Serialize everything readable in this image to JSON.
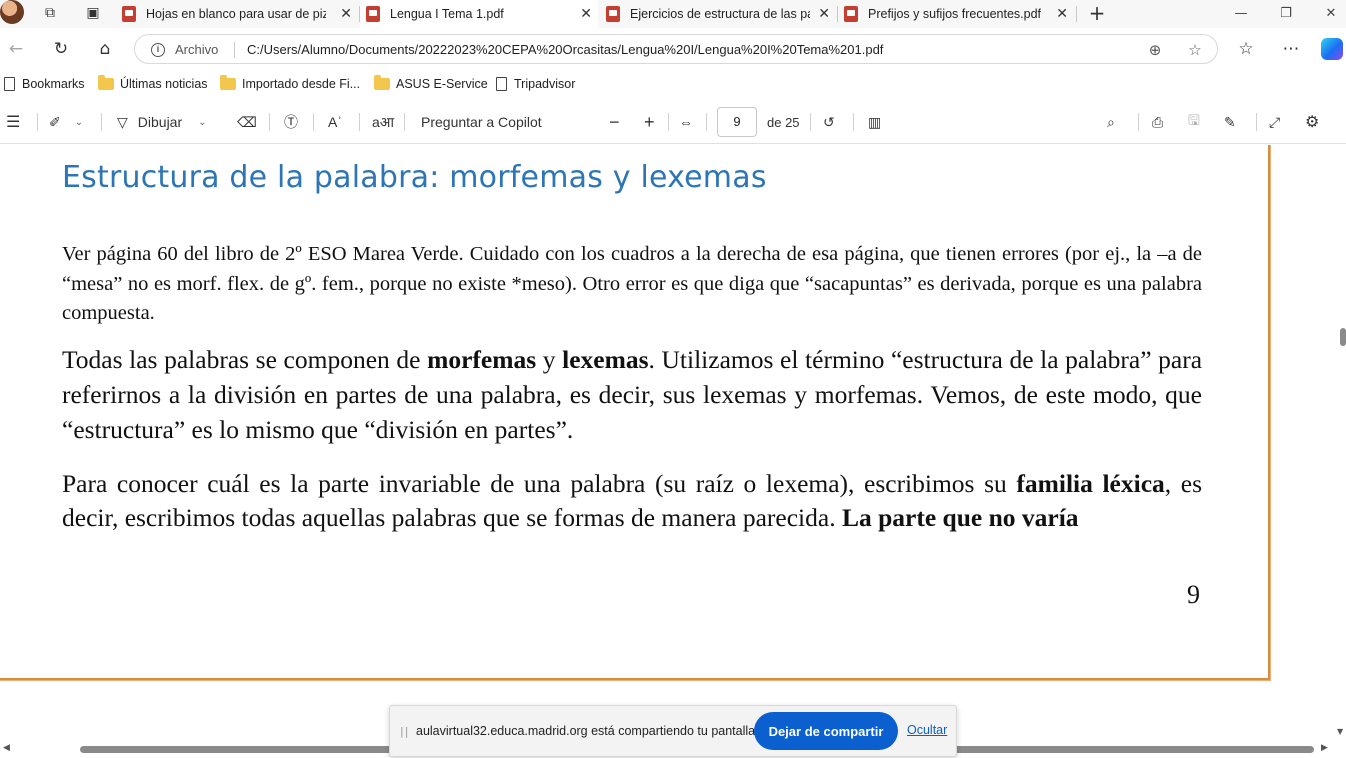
{
  "tabs": [
    {
      "label": "Hojas en blanco para usar de piza",
      "active": false
    },
    {
      "label": "Lengua I Tema 1.pdf",
      "active": true
    },
    {
      "label": "Ejercicios de estructura de las pal",
      "active": false
    },
    {
      "label": "Prefijos y sufijos frecuentes.pdf",
      "active": false
    }
  ],
  "address": {
    "site_info": "Archivo",
    "url": "C:/Users/Alumno/Documents/20222023%20CEPA%20Orcasitas/Lengua%20I/Lengua%20I%20Tema%201.pdf"
  },
  "bookmarks": [
    {
      "label": "Bookmarks",
      "icon": "doc-icon"
    },
    {
      "label": "Últimas noticias",
      "icon": "folder-icon"
    },
    {
      "label": "Importado desde Fi...",
      "icon": "folder-icon"
    },
    {
      "label": "ASUS E-Service",
      "icon": "folder-icon"
    },
    {
      "label": "Tripadvisor",
      "icon": "doc-icon"
    }
  ],
  "pdf_toolbar": {
    "draw_label": "Dibujar",
    "copilot_label": "Preguntar a Copilot",
    "page_current": "9",
    "page_total": "de 25"
  },
  "document": {
    "heading": "Estructura de la palabra: morfemas y lexemas",
    "p1": "Ver página 60 del libro de 2º ESO Marea Verde. Cuidado con los cuadros a la derecha de esa página, que tienen errores (por ej., la –a de “mesa” no es morf. flex. de gº. fem., porque no existe *meso). Otro error es que diga que “sacapuntas” es derivada, porque es una palabra compuesta.",
    "p2_a": "Todas las palabras se componen de ",
    "p2_b1": "morfemas",
    "p2_c": " y ",
    "p2_b2": "lexemas",
    "p2_d": ". Utilizamos el término “estructura de la palabra” para referirnos a la división en partes de una palabra, es decir, sus lexemas y morfemas. Vemos, de este modo, que “estructura” es lo mismo que “división en partes”.",
    "p3_a": "Para conocer cuál es la parte invariable de una palabra (su raíz o lexema), escribimos su ",
    "p3_b1": "familia léxica",
    "p3_c": ", es decir, escribimos todas aquellas palabras que se formas de manera parecida. ",
    "p3_b2": "La parte que no varía",
    "page_number": "9"
  },
  "share_banner": {
    "text": "aulavirtual32.educa.madrid.org está compartiendo tu pantalla.",
    "stop_button": "Dejar de compartir",
    "hide_link": "Ocultar"
  },
  "colors": {
    "heading": "#2e75b6",
    "page_border": "#d98c3a",
    "share_button": "#0b5fce",
    "pdf_tab_icon": "#c43e32"
  }
}
